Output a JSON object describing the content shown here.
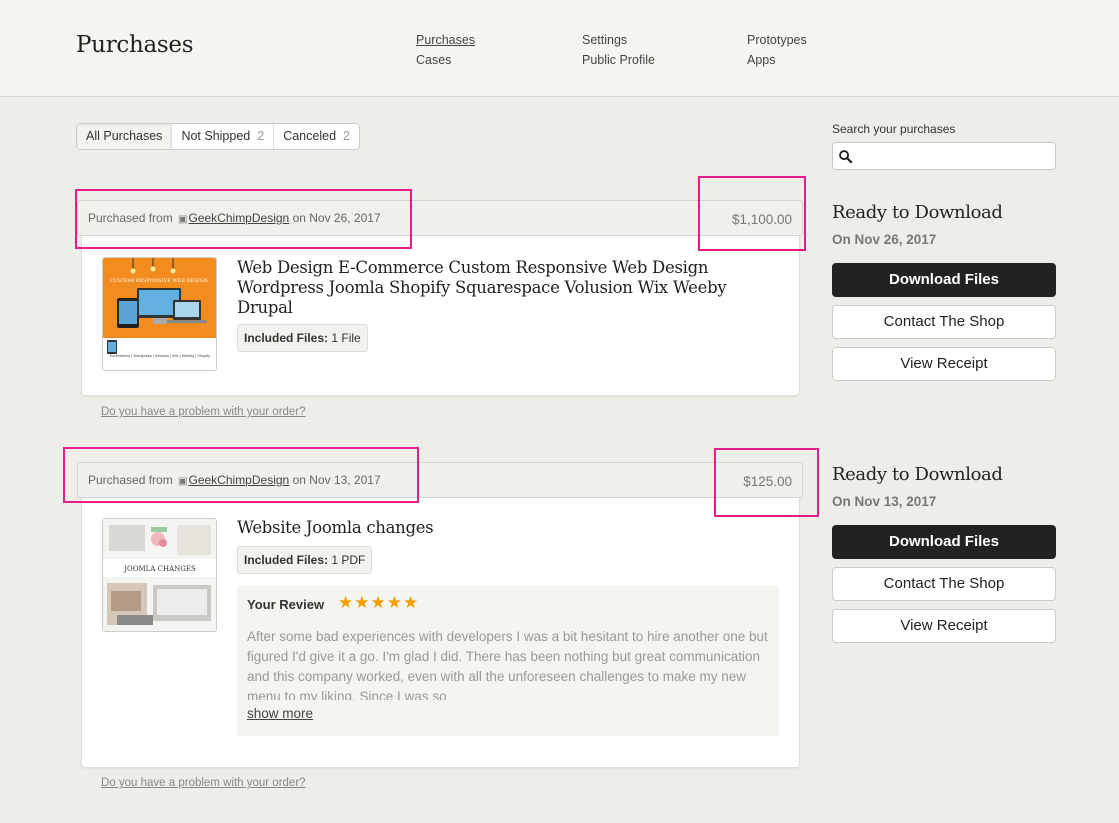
{
  "header": {
    "title": "Purchases",
    "nav": {
      "col1": [
        "Purchases",
        "Cases"
      ],
      "col2": [
        "Settings",
        "Public Profile"
      ],
      "col3": [
        "Prototypes",
        "Apps"
      ]
    }
  },
  "tabs": [
    {
      "label": "All Purchases",
      "count": ""
    },
    {
      "label": "Not Shipped",
      "count": "2"
    },
    {
      "label": "Canceled",
      "count": "2"
    }
  ],
  "search": {
    "label": "Search your purchases",
    "placeholder": ""
  },
  "orders": [
    {
      "from_prefix": "Purchased from",
      "shop": "GeekChimpDesign",
      "date_text": "on Nov 26, 2017",
      "price": "$1,100.00",
      "title": "Web Design E-Commerce Custom Responsive Web Design Wordpress Joomla Shopify Squarespace Volusion Wix Weeby Drupal",
      "files_label": "Included Files:",
      "files_value": "1 File",
      "problem_link": "Do you have a problem with your order?",
      "side": {
        "title": "Ready to Download",
        "date": "On Nov 26, 2017",
        "download": "Download Files",
        "contact": "Contact The Shop",
        "receipt": "View Receipt"
      }
    },
    {
      "from_prefix": "Purchased from",
      "shop": "GeekChimpDesign",
      "date_text": "on Nov 13, 2017",
      "price": "$125.00",
      "title": "Website Joomla changes",
      "files_label": "Included Files:",
      "files_value": "1 PDF",
      "review_label": "Your Review",
      "review_stars": 5,
      "review_text": "After some bad experiences with developers I was a bit hesitant to hire another one but figured I'd give it a go. I'm glad I did. There has been nothing but great communication and this company worked, even with all the unforeseen challenges to make my new menu to my liking. Since I was so",
      "show_more": "show more",
      "problem_link": "Do you have a problem with your order?",
      "side": {
        "title": "Ready to Download",
        "date": "On Nov 13, 2017",
        "download": "Download Files",
        "contact": "Contact The Shop",
        "receipt": "View Receipt"
      }
    }
  ],
  "thumbs": {
    "t1_banner": "CUSTOM RESPONSIVE WEB DESIGN",
    "t1_caption": "Ecommerce | Wordpress | Volusion | Wix | Weebly | Shopify",
    "t2_text": "JOOMLA CHANGES"
  },
  "colors": {
    "highlight": "#e61c8c",
    "star": "#f1a000",
    "dark_button": "#222222"
  }
}
